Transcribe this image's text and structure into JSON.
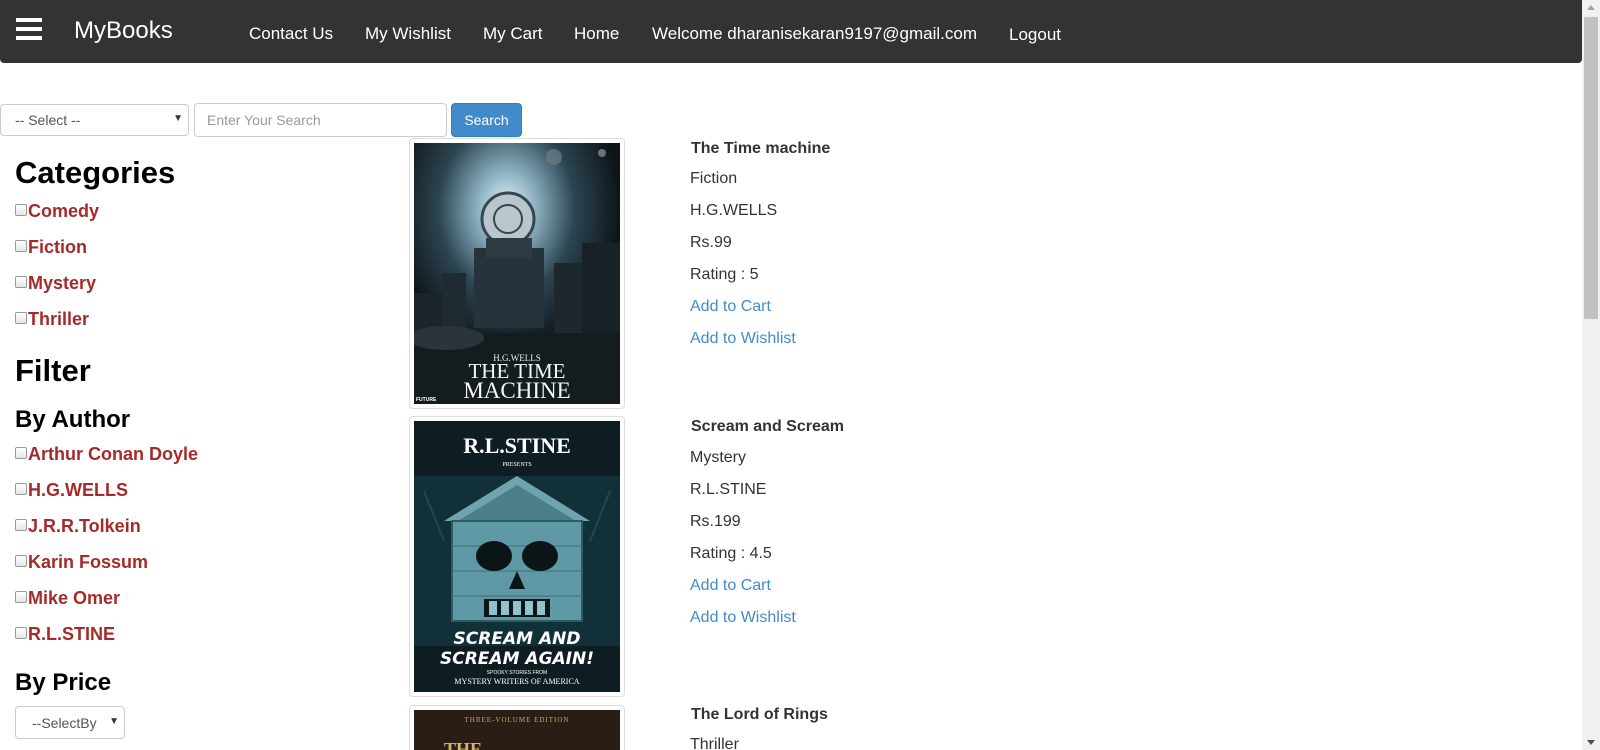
{
  "navbar": {
    "brand": "MyBooks",
    "menu_icon": "hamburger-menu-icon",
    "links": {
      "contact": "Contact Us",
      "wishlist": "My Wishlist",
      "cart": "My Cart",
      "home": "Home",
      "welcome": "Welcome dharanisekaran9197@gmail.com",
      "logout": "Logout"
    },
    "background": "#333333"
  },
  "search": {
    "select_value": "-- Select --",
    "input_placeholder": "Enter Your Search",
    "button_label": "Search",
    "button_color": "#428bca"
  },
  "sidebar": {
    "categories_title": "Categories",
    "categories": [
      "Comedy",
      "Fiction",
      "Mystery",
      "Thriller"
    ],
    "filter_title": "Filter",
    "by_author_title": "By Author",
    "authors": [
      "Arthur Conan Doyle",
      "H.G.WELLS",
      "J.R.R.Tolkein",
      "Karin Fossum",
      "Mike Omer",
      "R.L.STINE"
    ],
    "by_price_title": "By Price",
    "price_select_value": "--SelectBy",
    "label_color": "#a52a2a"
  },
  "books": [
    {
      "title": "The Time machine",
      "category": "Fiction",
      "author": "H.G.WELLS",
      "price": "Rs.99",
      "rating": "Rating : 5",
      "add_to_cart": "Add to Cart",
      "add_to_wishlist": "Add to Wishlist",
      "cover": {
        "author_text": "H.G.WELLS",
        "title_line1": "THE TIME",
        "title_line2": "MACHINE",
        "publisher": "FUTURE"
      }
    },
    {
      "title": "Scream and Scream",
      "category": "Mystery",
      "author": "R.L.STINE",
      "price": "Rs.199",
      "rating": "Rating : 4.5",
      "add_to_cart": "Add to Cart",
      "add_to_wishlist": "Add to Wishlist",
      "cover": {
        "author_text": "R.L.STINE",
        "presents": "PRESENTS",
        "title_line1": "SCREAM AND",
        "title_line2": "SCREAM AGAIN!",
        "tagline1": "SPOOKY STORIES FROM",
        "tagline2": "MYSTERY WRITERS OF AMERICA"
      }
    },
    {
      "title": "The Lord of Rings",
      "category": "Thriller",
      "cover": {
        "edition": "THREE-VOLUME EDITION",
        "title_fragment": "THE"
      }
    }
  ]
}
